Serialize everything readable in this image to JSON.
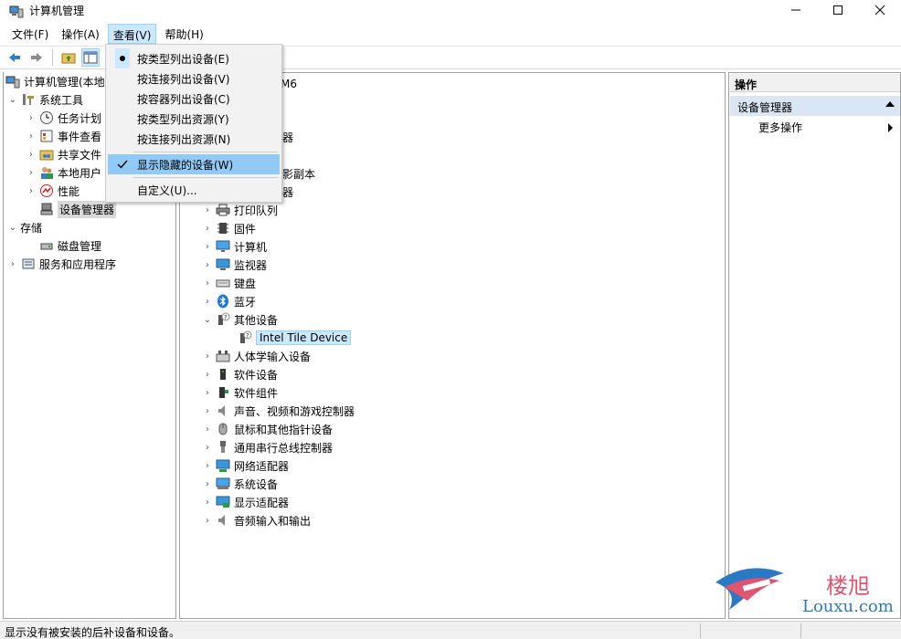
{
  "window": {
    "title": "计算机管理"
  },
  "menubar": {
    "items": [
      "文件(F)",
      "操作(A)",
      "查看(V)",
      "帮助(H)"
    ],
    "active_index": 2
  },
  "dropdown": {
    "items": [
      {
        "label": "按类型列出设备(E)",
        "mark": "bullet"
      },
      {
        "label": "按连接列出设备(V)",
        "mark": ""
      },
      {
        "label": "按容器列出设备(C)",
        "mark": ""
      },
      {
        "label": "按类型列出资源(Y)",
        "mark": ""
      },
      {
        "label": "按连接列出资源(N)",
        "mark": ""
      },
      {
        "label": "显示隐藏的设备(W)",
        "mark": "check"
      },
      {
        "label": "自定义(U)...",
        "mark": ""
      }
    ]
  },
  "left_tree": {
    "root": "计算机管理(本地",
    "system_tools": "系统工具",
    "task_scheduler": "任务计划",
    "event_viewer": "事件查看",
    "shared_folders": "共享文件",
    "local_users": "本地用户",
    "performance": "性能",
    "device_manager": "设备管理器",
    "storage": "存储",
    "disk_management": "磁盘管理",
    "services": "服务和应用程序"
  },
  "center_tree": {
    "partial_top": "M6",
    "partial_1": "器",
    "partial_2": "影副本",
    "partial_3": "器",
    "items": [
      "打印队列",
      "固件",
      "计算机",
      "监视器",
      "键盘",
      "蓝牙",
      "其他设备"
    ],
    "child": "Intel Tile Device",
    "items_after": [
      "人体学输入设备",
      "软件设备",
      "软件组件",
      "声音、视频和游戏控制器",
      "鼠标和其他指针设备",
      "通用串行总线控制器",
      "网络适配器",
      "系统设备",
      "显示适配器",
      "音频输入和输出"
    ]
  },
  "right_pane": {
    "header": "操作",
    "section": "设备管理器",
    "more_actions": "更多操作"
  },
  "status": {
    "text": "显示没有被安装的后补设备和设备。"
  },
  "watermark": {
    "cn": "楼旭",
    "en": "Louxu.com"
  },
  "colors": {
    "menu_highlight": "#91c9f7",
    "selection": "#cce8ff",
    "section_bg": "#dbe6f4"
  }
}
